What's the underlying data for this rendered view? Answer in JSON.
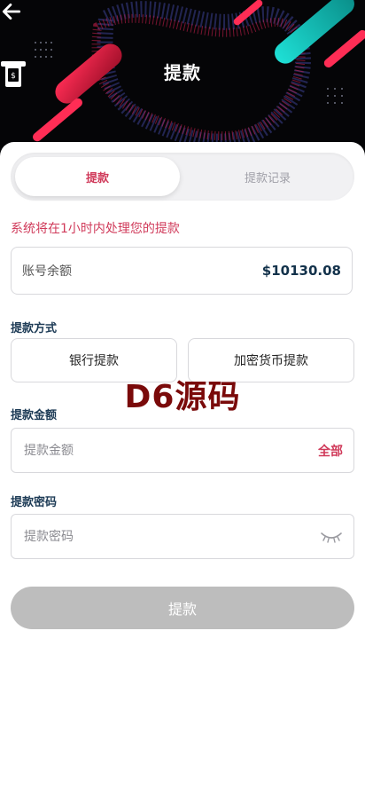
{
  "header": {
    "title": "提款",
    "back_icon": "arrow-left-icon",
    "title_icon": "atm-withdraw-icon"
  },
  "tabs": [
    {
      "label": "提款",
      "active": true
    },
    {
      "label": "提款记录",
      "active": false
    }
  ],
  "notice": "系统将在1小时内处理您的提款",
  "balance": {
    "label": "账号余额",
    "amount": "$10130.08"
  },
  "method": {
    "label": "提款方式",
    "options": [
      "银行提款",
      "加密货币提款"
    ]
  },
  "amount": {
    "label": "提款金额",
    "placeholder": "提款金额",
    "all_label": "全部"
  },
  "password": {
    "label": "提款密码",
    "placeholder": "提款密码",
    "toggle_icon": "eye-closed-icon"
  },
  "submit_label": "提款",
  "watermark": "D6源码",
  "colors": {
    "accent": "#d03a5a",
    "balance_text": "#13324b",
    "submit_disabled": "#bdbdbd",
    "header_bg": "#050507",
    "watermark": "#7a0a0a"
  }
}
